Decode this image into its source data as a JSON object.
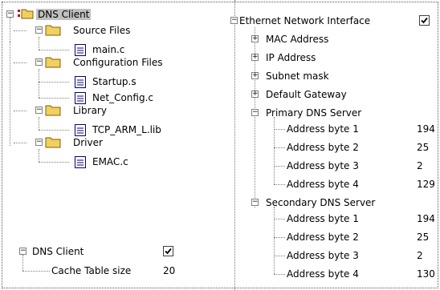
{
  "project_tree": {
    "root": "DNS Client",
    "groups": [
      {
        "label": "Source Files",
        "files": [
          "main.c"
        ]
      },
      {
        "label": "Configuration Files",
        "files": [
          "Startup.s",
          "Net_Config.c"
        ]
      },
      {
        "label": "Library",
        "files": [
          "TCP_ARM_L.lib"
        ]
      },
      {
        "label": "Driver",
        "files": [
          "EMAC.c"
        ]
      }
    ]
  },
  "dns_client": {
    "label": "DNS Client",
    "enabled": true,
    "cache_label": "Cache Table size",
    "cache_value": "20"
  },
  "eth": {
    "title": "Ethernet Network Interface",
    "enabled": true,
    "collapsed": [
      "MAC Address",
      "IP Address",
      "Subnet mask",
      "Default Gateway"
    ],
    "primary": {
      "label": "Primary DNS Server",
      "bytes": [
        {
          "label": "Address byte 1",
          "value": "194"
        },
        {
          "label": "Address byte 2",
          "value": "25"
        },
        {
          "label": "Address byte 3",
          "value": "2"
        },
        {
          "label": "Address byte 4",
          "value": "129"
        }
      ]
    },
    "secondary": {
      "label": "Secondary DNS Server",
      "bytes": [
        {
          "label": "Address byte 1",
          "value": "194"
        },
        {
          "label": "Address byte 2",
          "value": "25"
        },
        {
          "label": "Address byte 3",
          "value": "2"
        },
        {
          "label": "Address byte 4",
          "value": "130"
        }
      ]
    }
  }
}
